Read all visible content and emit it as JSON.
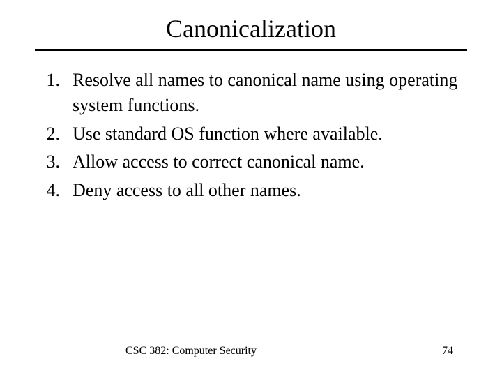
{
  "title": "Canonicalization",
  "items": [
    {
      "num": "1.",
      "text": "Resolve all names to canonical name using operating system functions."
    },
    {
      "num": "2.",
      "text": "Use standard OS function where available."
    },
    {
      "num": "3.",
      "text": "Allow access to correct canonical name."
    },
    {
      "num": "4.",
      "text": "Deny access to all other names."
    }
  ],
  "footer": {
    "course": "CSC 382: Computer Security",
    "page": "74"
  }
}
